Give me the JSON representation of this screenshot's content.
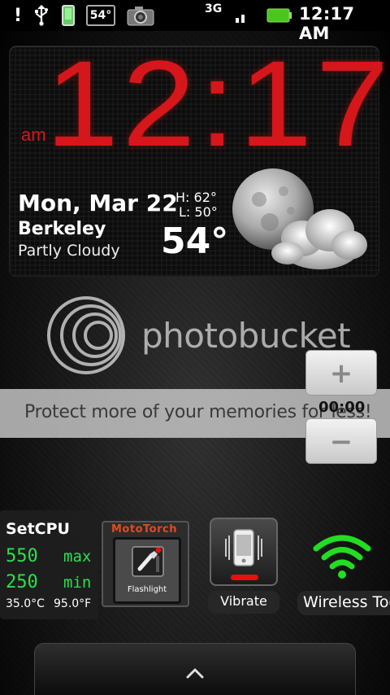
{
  "status_bar": {
    "notification_glyph": "!",
    "temp_badge": "54°",
    "network_type": "3G",
    "time": "12:17 AM",
    "icons": [
      "alert-icon",
      "usb-icon",
      "phone-icon",
      "temperature-badge",
      "camera-icon",
      "signal-icon",
      "battery-icon"
    ]
  },
  "clock_widget": {
    "time": "12:17",
    "am_pm": "am",
    "date": "Mon, Mar 22",
    "city": "Berkeley",
    "condition": "Partly Cloudy",
    "high": "H:  62°",
    "low": "L:  50°",
    "temperature": "54°",
    "accent_color": "#d5161b"
  },
  "watermark": {
    "brand": "photobucket",
    "banner": "Protect more of your memories for less!"
  },
  "timer": {
    "plus_label": "+",
    "minus_label": "−",
    "value": "00:00"
  },
  "setcpu": {
    "title": "SetCPU",
    "max_value": "550",
    "max_label": "max",
    "min_value": "250",
    "min_label": "min",
    "temp_c": "35.0°C",
    "temp_f": "95.0°F",
    "accent_color": "#27e24b"
  },
  "mototorch": {
    "title": "MotoTorch",
    "label": "Flashlight"
  },
  "vibrate": {
    "label": "Vibrate",
    "indicator_color": "#e51010"
  },
  "wireless": {
    "label": "Wireless Toggle",
    "color": "#22dd22"
  },
  "drawer": {
    "icon": "chevron-up-icon"
  }
}
